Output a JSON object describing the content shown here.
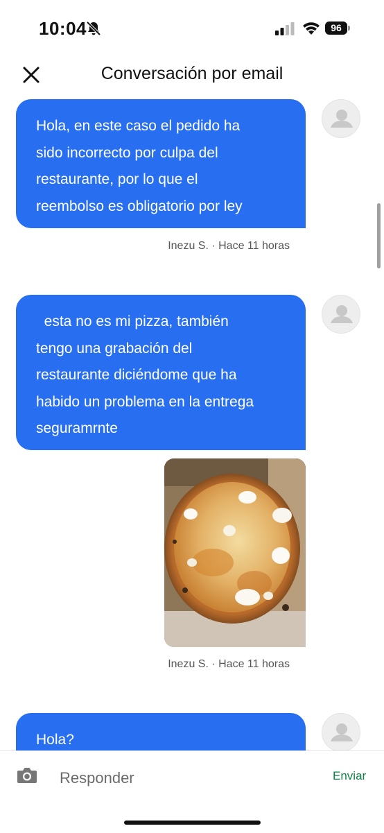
{
  "status_bar": {
    "time": "10:04",
    "battery": "96",
    "icons": [
      "bell-slash-icon",
      "cellular-signal-icon",
      "wifi-icon",
      "battery-icon"
    ]
  },
  "header": {
    "title": "Conversación por email",
    "close_icon": "close-icon"
  },
  "messages": [
    {
      "lines": [
        "Hola, en este caso el pedido ha",
        "sido incorrecto por culpa del",
        "restaurante, por lo que el",
        "reembolso es obligatorio por ley"
      ],
      "meta": "Inezu S. · Hace 11 horas"
    },
    {
      "lines": [
        "  esta no es mi pizza, también",
        "tengo una grabación del",
        "restaurante diciéndome que ha",
        "habido un problema en la entrega",
        "seguramrnte"
      ],
      "attachment": "photo-pizza",
      "meta": "Inezu S. · Hace 11 horas"
    },
    {
      "lines": [
        "Hola?"
      ]
    }
  ],
  "composer": {
    "placeholder": "Responder",
    "value": "",
    "send_label": "Enviar",
    "camera_icon": "camera-icon"
  },
  "colors": {
    "bubble": "#276ef1",
    "send": "#0e8345",
    "avatar_bg": "#eeeeee"
  }
}
